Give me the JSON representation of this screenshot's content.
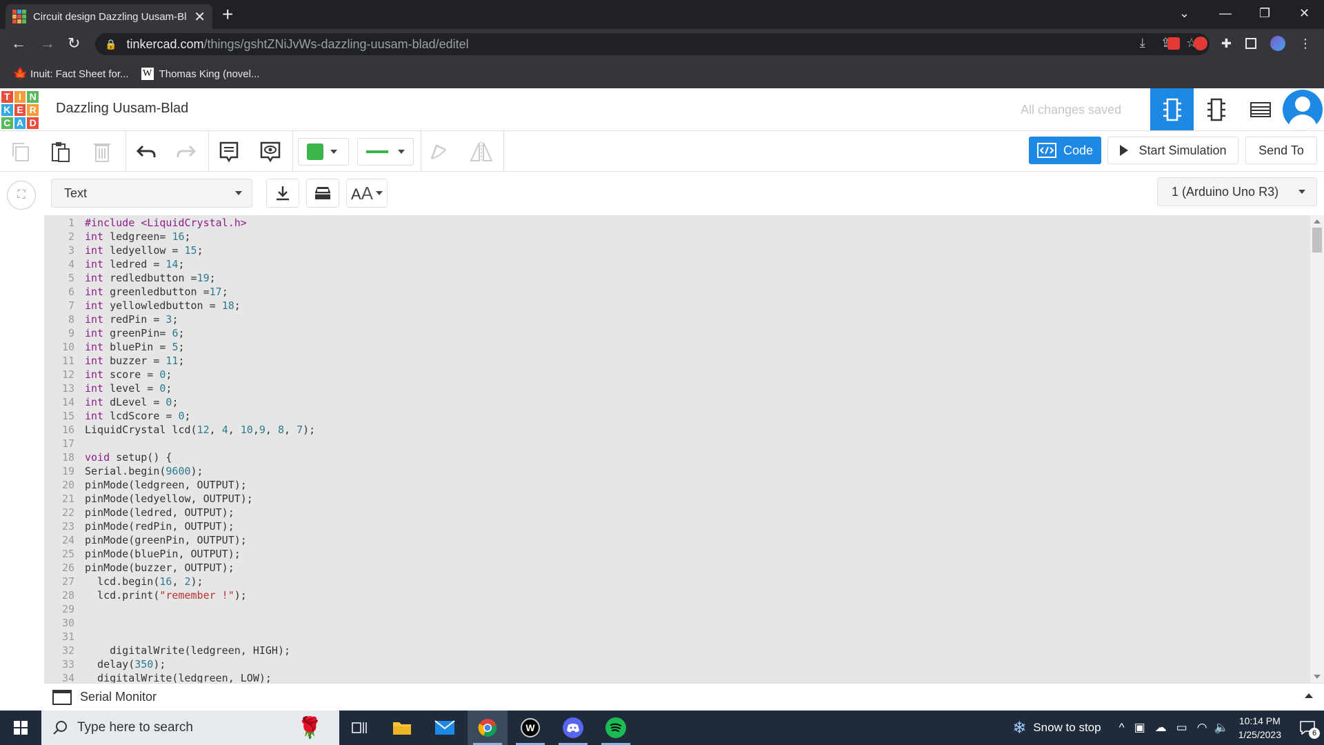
{
  "browser": {
    "tab_title": "Circuit design Dazzling Uusam-Bl",
    "url_host": "tinkercad.com",
    "url_path": "/things/gshtZNiJvWs-dazzling-uusam-blad/editel",
    "bookmarks": [
      {
        "label": "Inuit: Fact Sheet for...",
        "icon": "maple-leaf-icon"
      },
      {
        "label": "Thomas King (novel...",
        "icon": "wikipedia-icon"
      }
    ]
  },
  "app": {
    "design_title": "Dazzling Uusam-Blad",
    "save_status": "All changes saved",
    "accent_color": "#1e88e5"
  },
  "toolbar": {
    "code_label": "Code",
    "start_simulation_label": "Start Simulation",
    "send_to_label": "Send To",
    "wire_color": "#3cb44b"
  },
  "code_panel": {
    "mode": "Text",
    "device": "1 (Arduino Uno R3)",
    "serial_monitor_label": "Serial Monitor"
  },
  "code_lines": [
    [
      [
        "kw",
        "#include <LiquidCrystal.h>"
      ]
    ],
    [
      [
        "kw",
        "int"
      ],
      [
        "tx",
        " ledgreen= "
      ],
      [
        "num",
        "16"
      ],
      [
        "tx",
        ";"
      ]
    ],
    [
      [
        "kw",
        "int"
      ],
      [
        "tx",
        " ledyellow = "
      ],
      [
        "num",
        "15"
      ],
      [
        "tx",
        ";"
      ]
    ],
    [
      [
        "kw",
        "int"
      ],
      [
        "tx",
        " ledred = "
      ],
      [
        "num",
        "14"
      ],
      [
        "tx",
        ";"
      ]
    ],
    [
      [
        "kw",
        "int"
      ],
      [
        "tx",
        " redledbutton ="
      ],
      [
        "num",
        "19"
      ],
      [
        "tx",
        ";"
      ]
    ],
    [
      [
        "kw",
        "int"
      ],
      [
        "tx",
        " greenledbutton ="
      ],
      [
        "num",
        "17"
      ],
      [
        "tx",
        ";"
      ]
    ],
    [
      [
        "kw",
        "int"
      ],
      [
        "tx",
        " yellowledbutton = "
      ],
      [
        "num",
        "18"
      ],
      [
        "tx",
        ";"
      ]
    ],
    [
      [
        "kw",
        "int"
      ],
      [
        "tx",
        " redPin = "
      ],
      [
        "num",
        "3"
      ],
      [
        "tx",
        ";"
      ]
    ],
    [
      [
        "kw",
        "int"
      ],
      [
        "tx",
        " greenPin= "
      ],
      [
        "num",
        "6"
      ],
      [
        "tx",
        ";"
      ]
    ],
    [
      [
        "kw",
        "int"
      ],
      [
        "tx",
        " bluePin = "
      ],
      [
        "num",
        "5"
      ],
      [
        "tx",
        ";"
      ]
    ],
    [
      [
        "kw",
        "int"
      ],
      [
        "tx",
        " buzzer = "
      ],
      [
        "num",
        "11"
      ],
      [
        "tx",
        ";"
      ]
    ],
    [
      [
        "kw",
        "int"
      ],
      [
        "tx",
        " score = "
      ],
      [
        "num",
        "0"
      ],
      [
        "tx",
        ";"
      ]
    ],
    [
      [
        "kw",
        "int"
      ],
      [
        "tx",
        " level = "
      ],
      [
        "num",
        "0"
      ],
      [
        "tx",
        ";"
      ]
    ],
    [
      [
        "kw",
        "int"
      ],
      [
        "tx",
        " dLevel = "
      ],
      [
        "num",
        "0"
      ],
      [
        "tx",
        ";"
      ]
    ],
    [
      [
        "kw",
        "int"
      ],
      [
        "tx",
        " lcdScore = "
      ],
      [
        "num",
        "0"
      ],
      [
        "tx",
        ";"
      ]
    ],
    [
      [
        "tx",
        "LiquidCrystal lcd("
      ],
      [
        "num",
        "12"
      ],
      [
        "tx",
        ", "
      ],
      [
        "num",
        "4"
      ],
      [
        "tx",
        ", "
      ],
      [
        "num",
        "10"
      ],
      [
        "tx",
        ","
      ],
      [
        "num",
        "9"
      ],
      [
        "tx",
        ", "
      ],
      [
        "num",
        "8"
      ],
      [
        "tx",
        ", "
      ],
      [
        "num",
        "7"
      ],
      [
        "tx",
        ");"
      ]
    ],
    [],
    [
      [
        "kw",
        "void"
      ],
      [
        "tx",
        " setup() {"
      ]
    ],
    [
      [
        "tx",
        "Serial.begin("
      ],
      [
        "num",
        "9600"
      ],
      [
        "tx",
        ");"
      ]
    ],
    [
      [
        "tx",
        "pinMode(ledgreen, OUTPUT);"
      ]
    ],
    [
      [
        "tx",
        "pinMode(ledyellow, OUTPUT);"
      ]
    ],
    [
      [
        "tx",
        "pinMode(ledred, OUTPUT);"
      ]
    ],
    [
      [
        "tx",
        "pinMode(redPin, OUTPUT);"
      ]
    ],
    [
      [
        "tx",
        "pinMode(greenPin, OUTPUT);"
      ]
    ],
    [
      [
        "tx",
        "pinMode(bluePin, OUTPUT);"
      ]
    ],
    [
      [
        "tx",
        "pinMode(buzzer, OUTPUT);"
      ]
    ],
    [
      [
        "tx",
        "  lcd.begin("
      ],
      [
        "num",
        "16"
      ],
      [
        "tx",
        ", "
      ],
      [
        "num",
        "2"
      ],
      [
        "tx",
        ");"
      ]
    ],
    [
      [
        "tx",
        "  lcd.print("
      ],
      [
        "str",
        "\"remember !\""
      ],
      [
        "tx",
        ");"
      ]
    ],
    [],
    [],
    [],
    [
      [
        "tx",
        "    digitalWrite(ledgreen, HIGH);"
      ]
    ],
    [
      [
        "tx",
        "  delay("
      ],
      [
        "num",
        "350"
      ],
      [
        "tx",
        ");"
      ]
    ],
    [
      [
        "tx",
        "  digitalWrite(ledgreen, LOW);"
      ]
    ]
  ],
  "taskbar": {
    "search_placeholder": "Type here to search",
    "weather": "Snow to stop",
    "time": "10:14 PM",
    "date": "1/25/2023",
    "notification_count": "6"
  }
}
